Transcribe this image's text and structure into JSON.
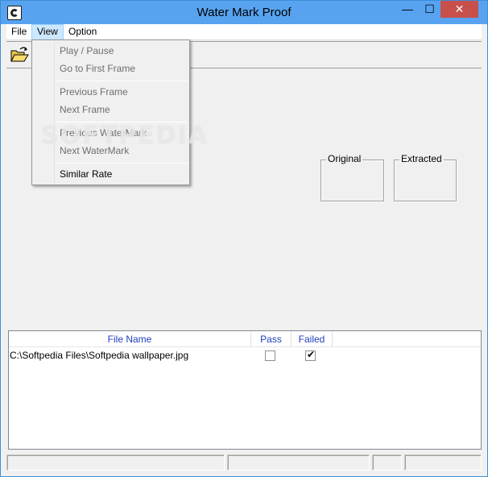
{
  "window": {
    "title": "Water Mark Proof",
    "minimize_glyph": "—",
    "maximize_glyph": "☐",
    "close_glyph": "✕"
  },
  "menubar": {
    "file": "File",
    "view": "View",
    "option": "Option"
  },
  "view_menu": {
    "items": [
      {
        "label": "Play / Pause",
        "enabled": false
      },
      {
        "label": "Go to First Frame",
        "enabled": false
      },
      {
        "label": "Previous Frame",
        "enabled": false
      },
      {
        "label": "Next Frame",
        "enabled": false
      },
      {
        "label": "Previous WaterMark",
        "enabled": false
      },
      {
        "label": "Next WaterMark",
        "enabled": false
      },
      {
        "label": "Similar Rate",
        "enabled": true
      }
    ]
  },
  "toolbar": {
    "open_icon": "open-folder-icon"
  },
  "panels": {
    "original": "Original",
    "extracted": "Extracted"
  },
  "list": {
    "columns": [
      "File Name",
      "Pass",
      "Failed"
    ],
    "rows": [
      {
        "file_name": "C:\\Softpedia Files\\Softpedia wallpaper.jpg",
        "pass": false,
        "failed": true
      }
    ]
  },
  "watermark_text": "SOFTPEDIA",
  "colors": {
    "titlebar": "#57a3f0",
    "close_button": "#c7504b",
    "header_text": "#1f3fbf",
    "menu_highlight": "#cce8ff"
  }
}
